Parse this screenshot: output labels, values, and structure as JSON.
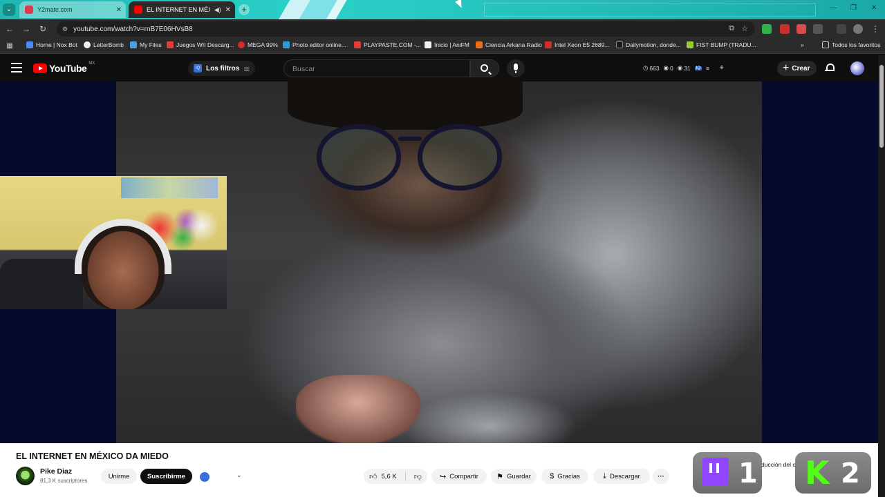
{
  "browser": {
    "tabs": [
      {
        "title": "Y2mate.com",
        "favicon_color": "#e0364f"
      },
      {
        "title": "EL INTERNET EN MÉXICO D",
        "favicon_color": "#ff0000"
      }
    ],
    "url": "youtube.com/watch?v=rnB7E06HVsB8",
    "bookmarks": [
      {
        "label": "Home | Nox Bot",
        "color": "#4b8bf5"
      },
      {
        "label": "LetterBomb",
        "color": "#f2f2f2"
      },
      {
        "label": "My Files",
        "color": "#4aa3df"
      },
      {
        "label": "Juegos WII Descarg...",
        "color": "#e23c3c"
      },
      {
        "label": "MEGA 99%",
        "color": "#d9272e"
      },
      {
        "label": "Photo editor online...",
        "color": "#2f9ad8"
      },
      {
        "label": "PLAYPASTE.COM -...",
        "color": "#e63939"
      },
      {
        "label": "Inicio | AniFM",
        "color": "#f0f0f0"
      },
      {
        "label": "Ciencia Arkana Radio",
        "color": "#ef6c1a"
      },
      {
        "label": "Intel Xeon E5 2689...",
        "color": "#d12d2d"
      },
      {
        "label": "Dailymotion, donde...",
        "color": "#1a1a1a"
      },
      {
        "label": "FIST BUMP (TRADU...",
        "color": "#9acd32"
      }
    ],
    "all_bookmarks": "Todos los favoritos"
  },
  "youtube": {
    "logo_text": "YouTube",
    "country": "MX",
    "filters_label": "Los filtros",
    "search_placeholder": "Buscar",
    "stats": {
      "views": "663",
      "a": "0",
      "b": "31"
    },
    "create_label": "Crear"
  },
  "video": {
    "title": "EL INTERNET EN MÉXICO DA MIEDO",
    "channel": "Pike Diaz",
    "subscribers": "81,3 K suscriptores",
    "join_label": "Unirme",
    "subscribe_label": "Suscribirme",
    "likes": "5,6 K",
    "share_label": "Compartir",
    "save_label": "Guardar",
    "thanks_label": "Gracias",
    "download_label": "Descargar",
    "chat_replay": "Mostrar reproducción del c"
  },
  "overlay": {
    "twitch_number": "1",
    "kick_number": "2",
    "kick_letter": "K"
  }
}
